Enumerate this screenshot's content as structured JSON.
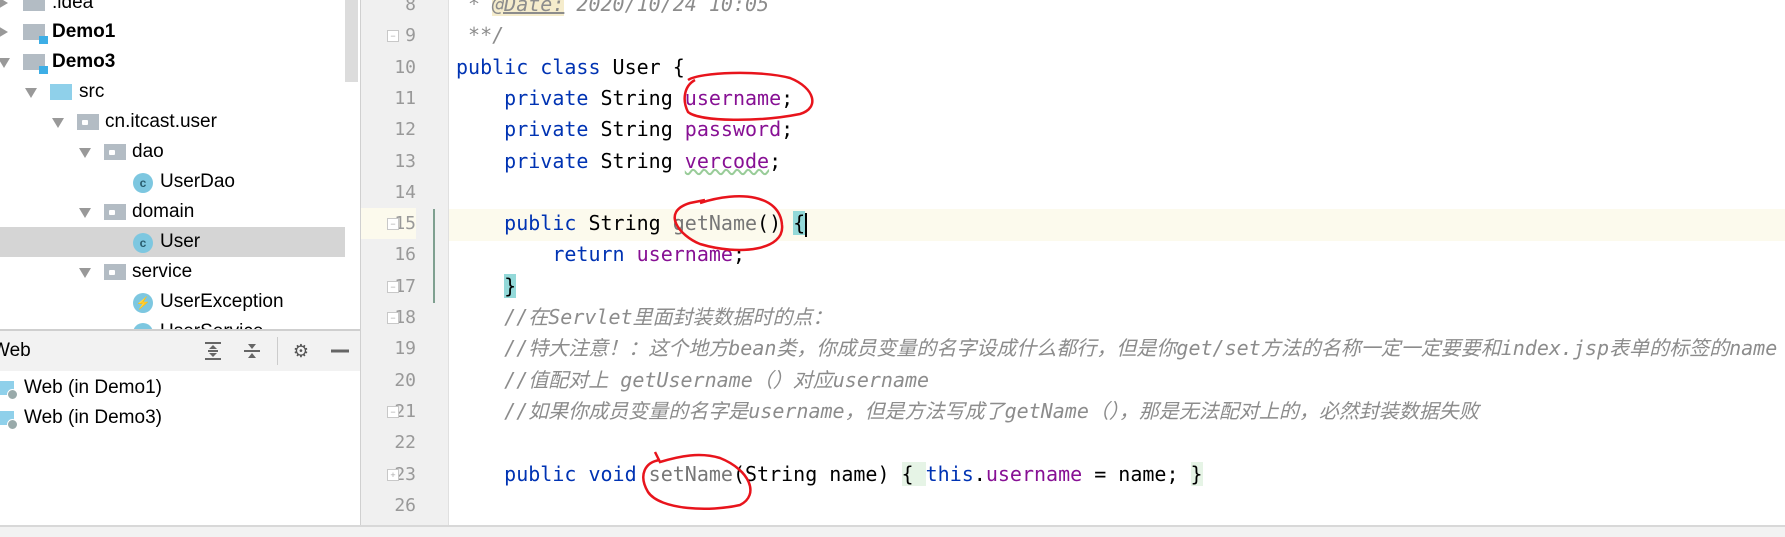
{
  "project_tree": {
    "items": [
      {
        "label": ".idea",
        "kind": "folder",
        "arrow": "right",
        "bold": false
      },
      {
        "label": "Demo1",
        "kind": "module",
        "arrow": "right",
        "bold": true
      },
      {
        "label": "Demo3",
        "kind": "module",
        "arrow": "down",
        "bold": true
      },
      {
        "label": "src",
        "kind": "source-folder",
        "arrow": "down",
        "bold": false
      },
      {
        "label": "cn.itcast.user",
        "kind": "package",
        "arrow": "down",
        "bold": false
      },
      {
        "label": "dao",
        "kind": "package",
        "arrow": "down",
        "bold": false
      },
      {
        "label": "UserDao",
        "kind": "class",
        "arrow": "",
        "bold": false
      },
      {
        "label": "domain",
        "kind": "package",
        "arrow": "down",
        "bold": false
      },
      {
        "label": "User",
        "kind": "class",
        "arrow": "",
        "bold": false,
        "selected": true
      },
      {
        "label": "service",
        "kind": "package",
        "arrow": "down",
        "bold": false
      },
      {
        "label": "UserException",
        "kind": "exception",
        "arrow": "",
        "bold": false
      },
      {
        "label": "UserService",
        "kind": "class",
        "arrow": "",
        "bold": false
      }
    ]
  },
  "web_panel": {
    "title": "Web",
    "items": [
      "Web (in Demo1)",
      "Web (in Demo3)"
    ],
    "icons": [
      "expand-all-icon",
      "collapse-all-icon",
      "gear-icon",
      "minimize-icon"
    ]
  },
  "editor": {
    "line_numbers": [
      "8",
      "9",
      "10",
      "11",
      "12",
      "13",
      "14",
      "15",
      "16",
      "17",
      "18",
      "19",
      "20",
      "21",
      "22",
      "23",
      "26"
    ],
    "lines": [
      [
        {
          "t": " * ",
          "c": "cm"
        },
        {
          "t": "@Date:",
          "c": "tag"
        },
        {
          "t": " 2020/10/24 10:05",
          "c": "cm"
        }
      ],
      [
        {
          "t": " **/",
          "c": "cm"
        }
      ],
      [
        {
          "t": "public class ",
          "c": "kw"
        },
        {
          "t": "User {",
          "c": ""
        }
      ],
      [
        {
          "t": "    private ",
          "c": "kw"
        },
        {
          "t": "String ",
          "c": ""
        },
        {
          "t": "username",
          "c": "fld"
        },
        {
          "t": ";",
          "c": ""
        }
      ],
      [
        {
          "t": "    private ",
          "c": "kw"
        },
        {
          "t": "String ",
          "c": ""
        },
        {
          "t": "password",
          "c": "fld"
        },
        {
          "t": ";",
          "c": ""
        }
      ],
      [
        {
          "t": "    private ",
          "c": "kw"
        },
        {
          "t": "String ",
          "c": ""
        },
        {
          "t": "vercode",
          "c": "fld wavy"
        },
        {
          "t": ";",
          "c": ""
        }
      ],
      [],
      [
        {
          "t": "    public ",
          "c": "kw"
        },
        {
          "t": "String ",
          "c": ""
        },
        {
          "t": "getName",
          "c": "mth"
        },
        {
          "t": "() ",
          "c": ""
        },
        {
          "t": "{",
          "c": "brace-hl"
        }
      ],
      [
        {
          "t": "        return ",
          "c": "kw"
        },
        {
          "t": "username",
          "c": "fld"
        },
        {
          "t": ";",
          "c": ""
        }
      ],
      [
        {
          "t": "    ",
          "c": ""
        },
        {
          "t": "}",
          "c": "brace-hl"
        }
      ],
      [
        {
          "t": "    //在Servlet里面封装数据时的点：",
          "c": "cm"
        }
      ],
      [
        {
          "t": "    //特大注意！：这个地方bean类，你成员变量的名字设成什么都行，但是你get/set方法的名称一定一定要要和index.jsp表单的标签的name",
          "c": "cm"
        }
      ],
      [
        {
          "t": "    //值配对上 getUsername（）对应username",
          "c": "cm"
        }
      ],
      [
        {
          "t": "    //如果你成员变量的名字是username，但是方法写成了getName（），那是无法配对上的，必然封装数据失败",
          "c": "cm"
        }
      ],
      [],
      [
        {
          "t": "    public void ",
          "c": "kw"
        },
        {
          "t": "setName",
          "c": "mth"
        },
        {
          "t": "(String name) ",
          "c": ""
        },
        {
          "t": "{ ",
          "c": "brace-hl2"
        },
        {
          "t": "this",
          "c": "kw"
        },
        {
          "t": ".",
          "c": ""
        },
        {
          "t": "username",
          "c": "fld"
        },
        {
          "t": " = name; ",
          "c": ""
        },
        {
          "t": "}",
          "c": "brace-hl2"
        }
      ],
      []
    ],
    "current_line": "15"
  },
  "colors": {
    "keyword": "#0033b3",
    "field": "#871094",
    "comment": "#8c8c8c",
    "annotation_red": "#e8141c",
    "current_line_bg": "#fcfaed",
    "selection": "#d5d5d5"
  }
}
